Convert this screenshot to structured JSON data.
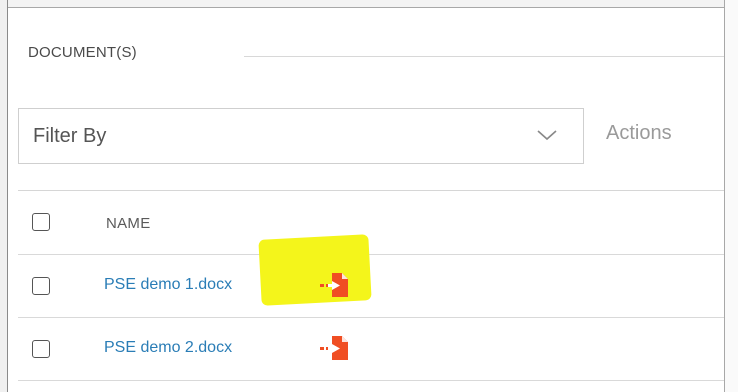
{
  "section": {
    "title": "DOCUMENT(S)"
  },
  "filter": {
    "placeholder": "Filter By",
    "icon": "chevron-down-icon"
  },
  "actions": {
    "label": "Actions"
  },
  "table": {
    "columns": [
      "NAME"
    ],
    "rows": [
      {
        "name": "PSE demo 1.docx",
        "icon": "file-export-icon",
        "highlighted": true
      },
      {
        "name": "PSE demo 2.docx",
        "icon": "file-export-icon",
        "highlighted": false
      }
    ]
  },
  "colors": {
    "link": "#2a7db6",
    "icon": "#f04e23",
    "highlight": "#f4f51b"
  }
}
